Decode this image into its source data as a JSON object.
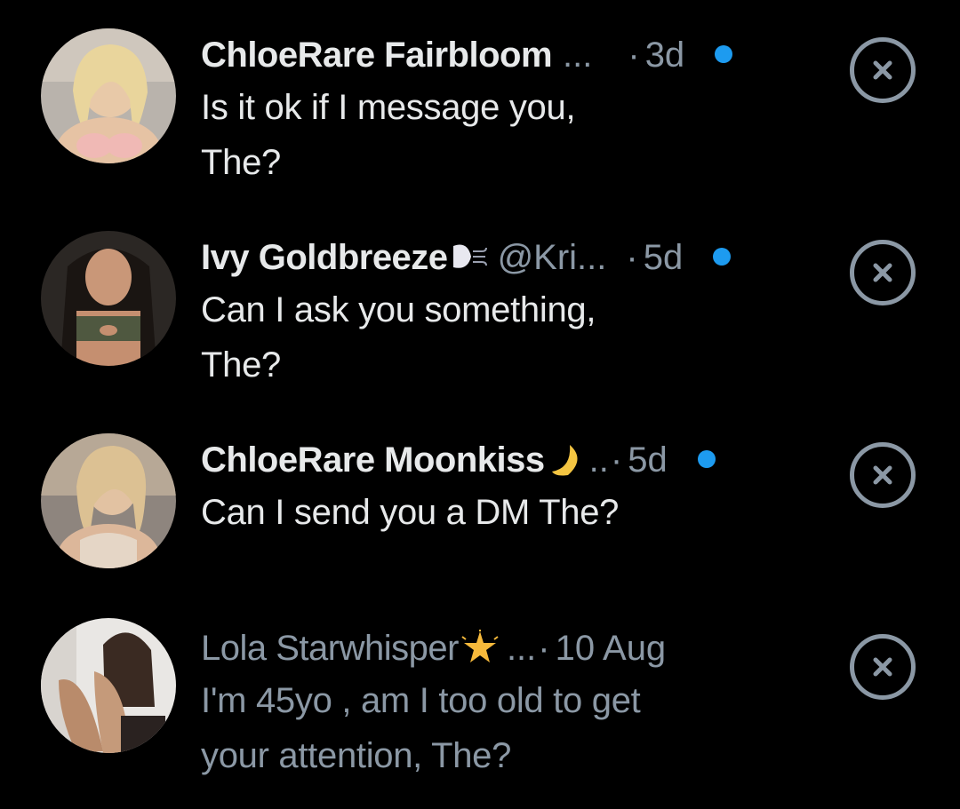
{
  "rows": [
    {
      "name": "ChloeRare Fairbloom",
      "handle": "",
      "truncation": "...",
      "separator": "·",
      "time": "3d",
      "message_line1": "Is it ok if I message you,",
      "message_line2": "The?",
      "unread": true,
      "emoji": ""
    },
    {
      "name": "Ivy Goldbreeze",
      "handle": "@Kri...",
      "truncation": "",
      "separator": "·",
      "time": "5d",
      "message_line1": "Can I ask you something,",
      "message_line2": "The?",
      "unread": true,
      "emoji": "wind-face"
    },
    {
      "name": "ChloeRare Moonkiss",
      "handle": "",
      "truncation": "..",
      "separator": "·",
      "time": "5d",
      "message_line1": "Can I send you a DM The?",
      "message_line2": "",
      "unread": true,
      "emoji": "crescent-moon"
    },
    {
      "name": "Lola Starwhisper",
      "handle": "",
      "truncation": "...",
      "separator": "·",
      "time": "10 Aug",
      "message_line1": "I'm 45yo , am I too old to get",
      "message_line2": "your attention, The?",
      "unread": false,
      "emoji": "glowing-star"
    }
  ],
  "colors": {
    "background": "#000000",
    "primary_text": "#e7e9ea",
    "secondary_text": "#8b98a5",
    "unread_dot": "#1d9bf0"
  },
  "icons": {
    "dismiss": "close-circle-icon"
  }
}
